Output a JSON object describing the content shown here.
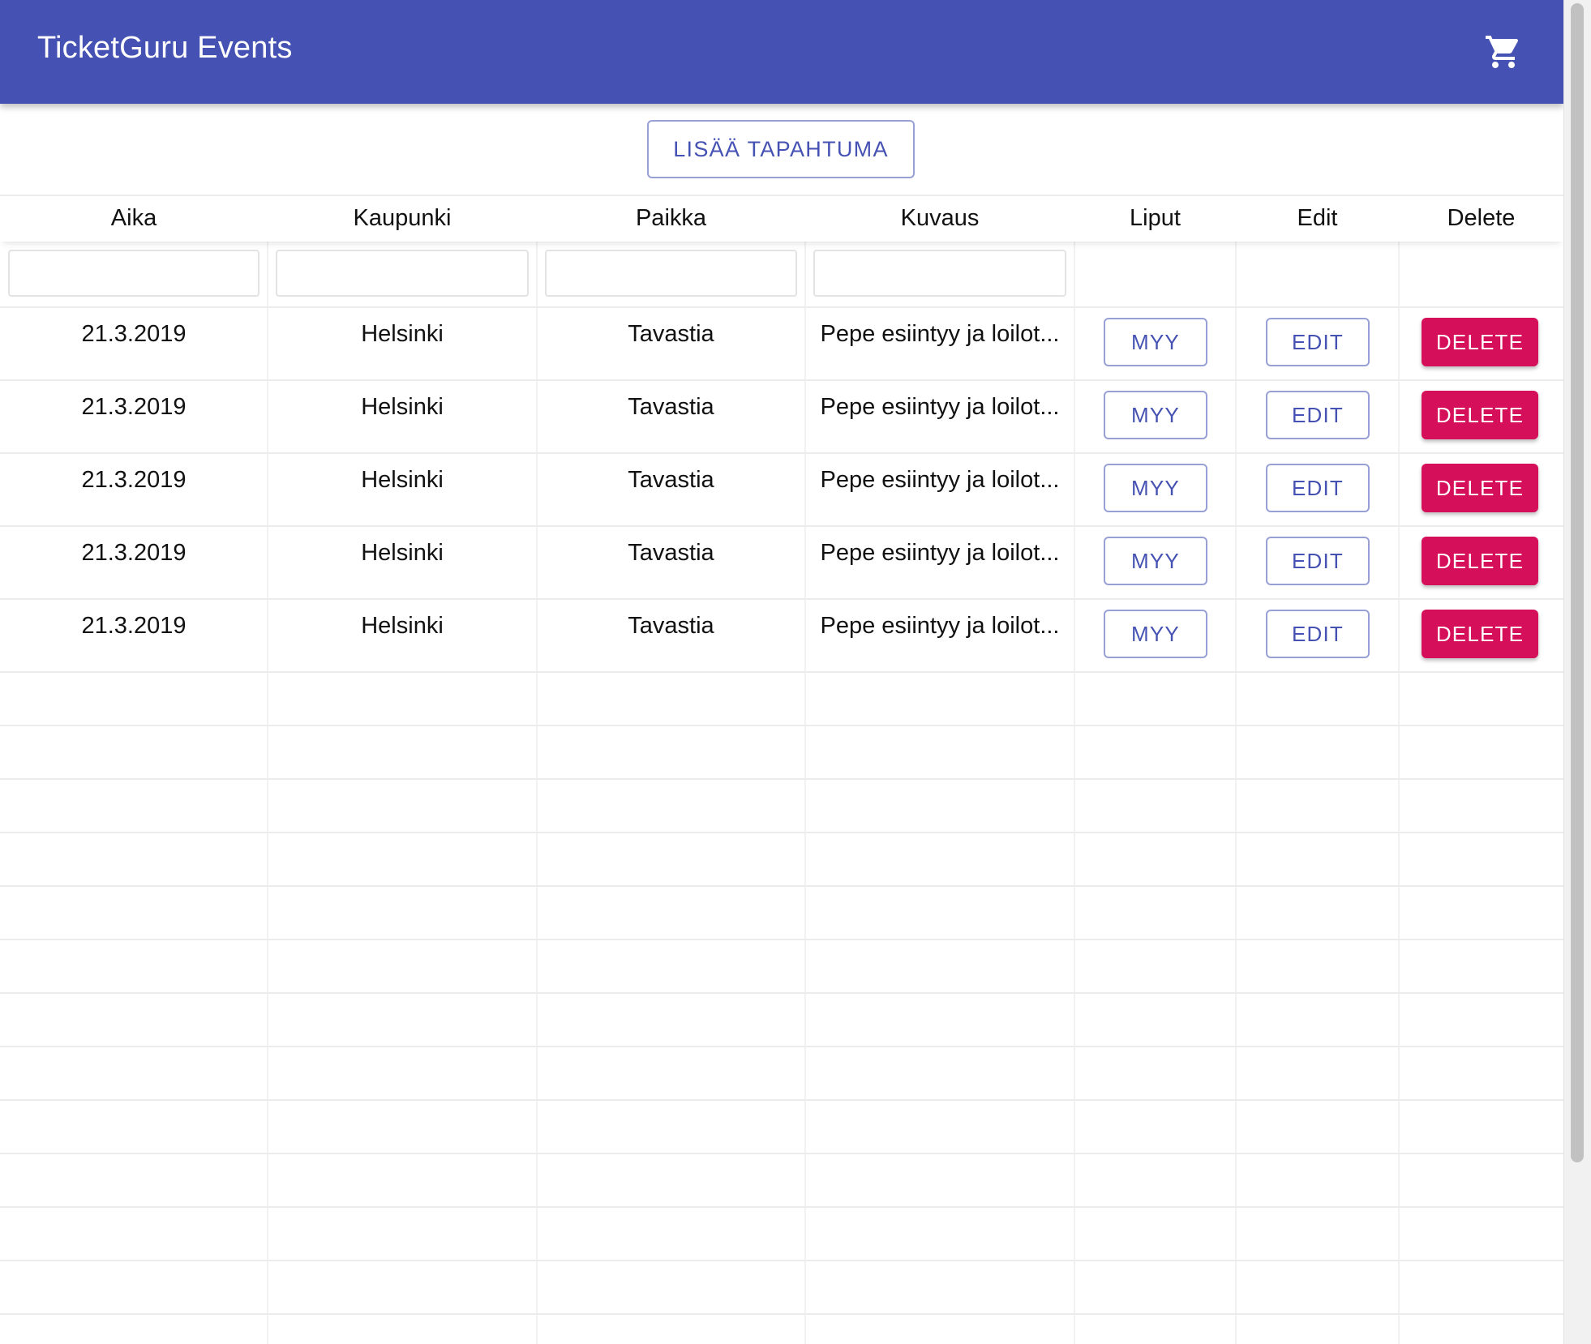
{
  "appbar": {
    "title": "TicketGuru Events",
    "cart_icon": "shopping-cart-icon"
  },
  "toolbar": {
    "add_label": "LISÄÄ TAPAHTUMA"
  },
  "table": {
    "columns": [
      "Aika",
      "Kaupunki",
      "Paikka",
      "Kuvaus",
      "Liput",
      "Edit",
      "Delete"
    ],
    "filters": [
      "",
      "",
      "",
      ""
    ],
    "rows": [
      {
        "aika": "21.3.2019",
        "kaupunki": "Helsinki",
        "paikka": "Tavastia",
        "kuvaus": "Pepe esiintyy ja loilot...",
        "sell": "MYY",
        "edit": "EDIT",
        "delete": "DELETE"
      },
      {
        "aika": "21.3.2019",
        "kaupunki": "Helsinki",
        "paikka": "Tavastia",
        "kuvaus": "Pepe esiintyy ja loilot...",
        "sell": "MYY",
        "edit": "EDIT",
        "delete": "DELETE"
      },
      {
        "aika": "21.3.2019",
        "kaupunki": "Helsinki",
        "paikka": "Tavastia",
        "kuvaus": "Pepe esiintyy ja loilot...",
        "sell": "MYY",
        "edit": "EDIT",
        "delete": "DELETE"
      },
      {
        "aika": "21.3.2019",
        "kaupunki": "Helsinki",
        "paikka": "Tavastia",
        "kuvaus": "Pepe esiintyy ja loilot...",
        "sell": "MYY",
        "edit": "EDIT",
        "delete": "DELETE"
      },
      {
        "aika": "21.3.2019",
        "kaupunki": "Helsinki",
        "paikka": "Tavastia",
        "kuvaus": "Pepe esiintyy ja loilot...",
        "sell": "MYY",
        "edit": "EDIT",
        "delete": "DELETE"
      }
    ]
  },
  "colors": {
    "primary": "#4652b3",
    "delete": "#d60f5b"
  }
}
